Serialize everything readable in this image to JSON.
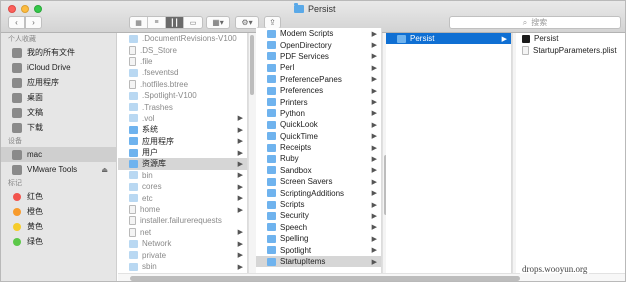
{
  "window": {
    "title": "Persist"
  },
  "toolbar": {
    "back_icon": "chevron-left-icon",
    "forward_icon": "chevron-right-icon",
    "view_modes": [
      "icon-view",
      "list-view",
      "column-view",
      "cover-flow-view"
    ],
    "search_placeholder": "搜索"
  },
  "sidebar": {
    "favorites_header": "个人收藏",
    "favorites": [
      {
        "label": "我的所有文件",
        "icon": "all-files-icon"
      },
      {
        "label": "iCloud Drive",
        "icon": "cloud-icon"
      },
      {
        "label": "应用程序",
        "icon": "applications-icon"
      },
      {
        "label": "桌面",
        "icon": "desktop-icon"
      },
      {
        "label": "文稿",
        "icon": "documents-icon"
      },
      {
        "label": "下载",
        "icon": "downloads-icon"
      }
    ],
    "devices_header": "设备",
    "devices": [
      {
        "label": "mac",
        "icon": "computer-icon"
      },
      {
        "label": "VMware Tools",
        "icon": "disk-icon"
      }
    ],
    "tags_header": "标记",
    "tags": [
      {
        "label": "红色",
        "color": "#f2544d"
      },
      {
        "label": "橙色",
        "color": "#f79b2d"
      },
      {
        "label": "黄色",
        "color": "#f5cc2b"
      },
      {
        "label": "绿色",
        "color": "#5cc849"
      }
    ]
  },
  "columns": {
    "col1": [
      {
        "name": ".DocumentRevisions-V100",
        "dim": true,
        "folder": true
      },
      {
        "name": ".DS_Store",
        "dim": true,
        "folder": false
      },
      {
        "name": ".file",
        "dim": true,
        "folder": false
      },
      {
        "name": ".fseventsd",
        "dim": true,
        "folder": true
      },
      {
        "name": ".hotfiles.btree",
        "dim": true,
        "folder": false
      },
      {
        "name": ".Spotlight-V100",
        "dim": true,
        "folder": true
      },
      {
        "name": ".Trashes",
        "dim": true,
        "folder": true
      },
      {
        "name": ".vol",
        "dim": true,
        "folder": true,
        "chev": true
      },
      {
        "name": "系统",
        "dim": false,
        "folder": true,
        "chev": true
      },
      {
        "name": "应用程序",
        "dim": false,
        "folder": true,
        "chev": true
      },
      {
        "name": "用户",
        "dim": false,
        "folder": true,
        "chev": true
      },
      {
        "name": "资源库",
        "dim": false,
        "folder": true,
        "chev": true,
        "selected": true
      },
      {
        "name": "bin",
        "dim": true,
        "folder": true,
        "chev": true
      },
      {
        "name": "cores",
        "dim": true,
        "folder": true,
        "chev": true
      },
      {
        "name": "etc",
        "dim": true,
        "folder": true,
        "chev": true
      },
      {
        "name": "home",
        "dim": true,
        "folder": false,
        "chev": true
      },
      {
        "name": "installer.failurerequests",
        "dim": true,
        "folder": false
      },
      {
        "name": "net",
        "dim": true,
        "folder": false,
        "chev": true
      },
      {
        "name": "Network",
        "dim": true,
        "folder": true,
        "chev": true
      },
      {
        "name": "private",
        "dim": true,
        "folder": true,
        "chev": true
      },
      {
        "name": "sbin",
        "dim": true,
        "folder": true,
        "chev": true
      }
    ],
    "col2": [
      {
        "name": "Modem Scripts"
      },
      {
        "name": "OpenDirectory"
      },
      {
        "name": "PDF Services"
      },
      {
        "name": "Perl"
      },
      {
        "name": "PreferencePanes"
      },
      {
        "name": "Preferences"
      },
      {
        "name": "Printers"
      },
      {
        "name": "Python"
      },
      {
        "name": "QuickLook"
      },
      {
        "name": "QuickTime"
      },
      {
        "name": "Receipts"
      },
      {
        "name": "Ruby"
      },
      {
        "name": "Sandbox"
      },
      {
        "name": "Screen Savers"
      },
      {
        "name": "ScriptingAdditions"
      },
      {
        "name": "Scripts"
      },
      {
        "name": "Security"
      },
      {
        "name": "Speech"
      },
      {
        "name": "Spelling"
      },
      {
        "name": "Spotlight"
      },
      {
        "name": "StartupItems",
        "selected": true
      }
    ],
    "col3": [
      {
        "name": "Persist",
        "selected": true
      }
    ],
    "col4": [
      {
        "name": "Persist",
        "kind": "executable"
      },
      {
        "name": "StartupParameters.plist",
        "kind": "document"
      }
    ]
  },
  "watermark": "drops.wooyun.org"
}
